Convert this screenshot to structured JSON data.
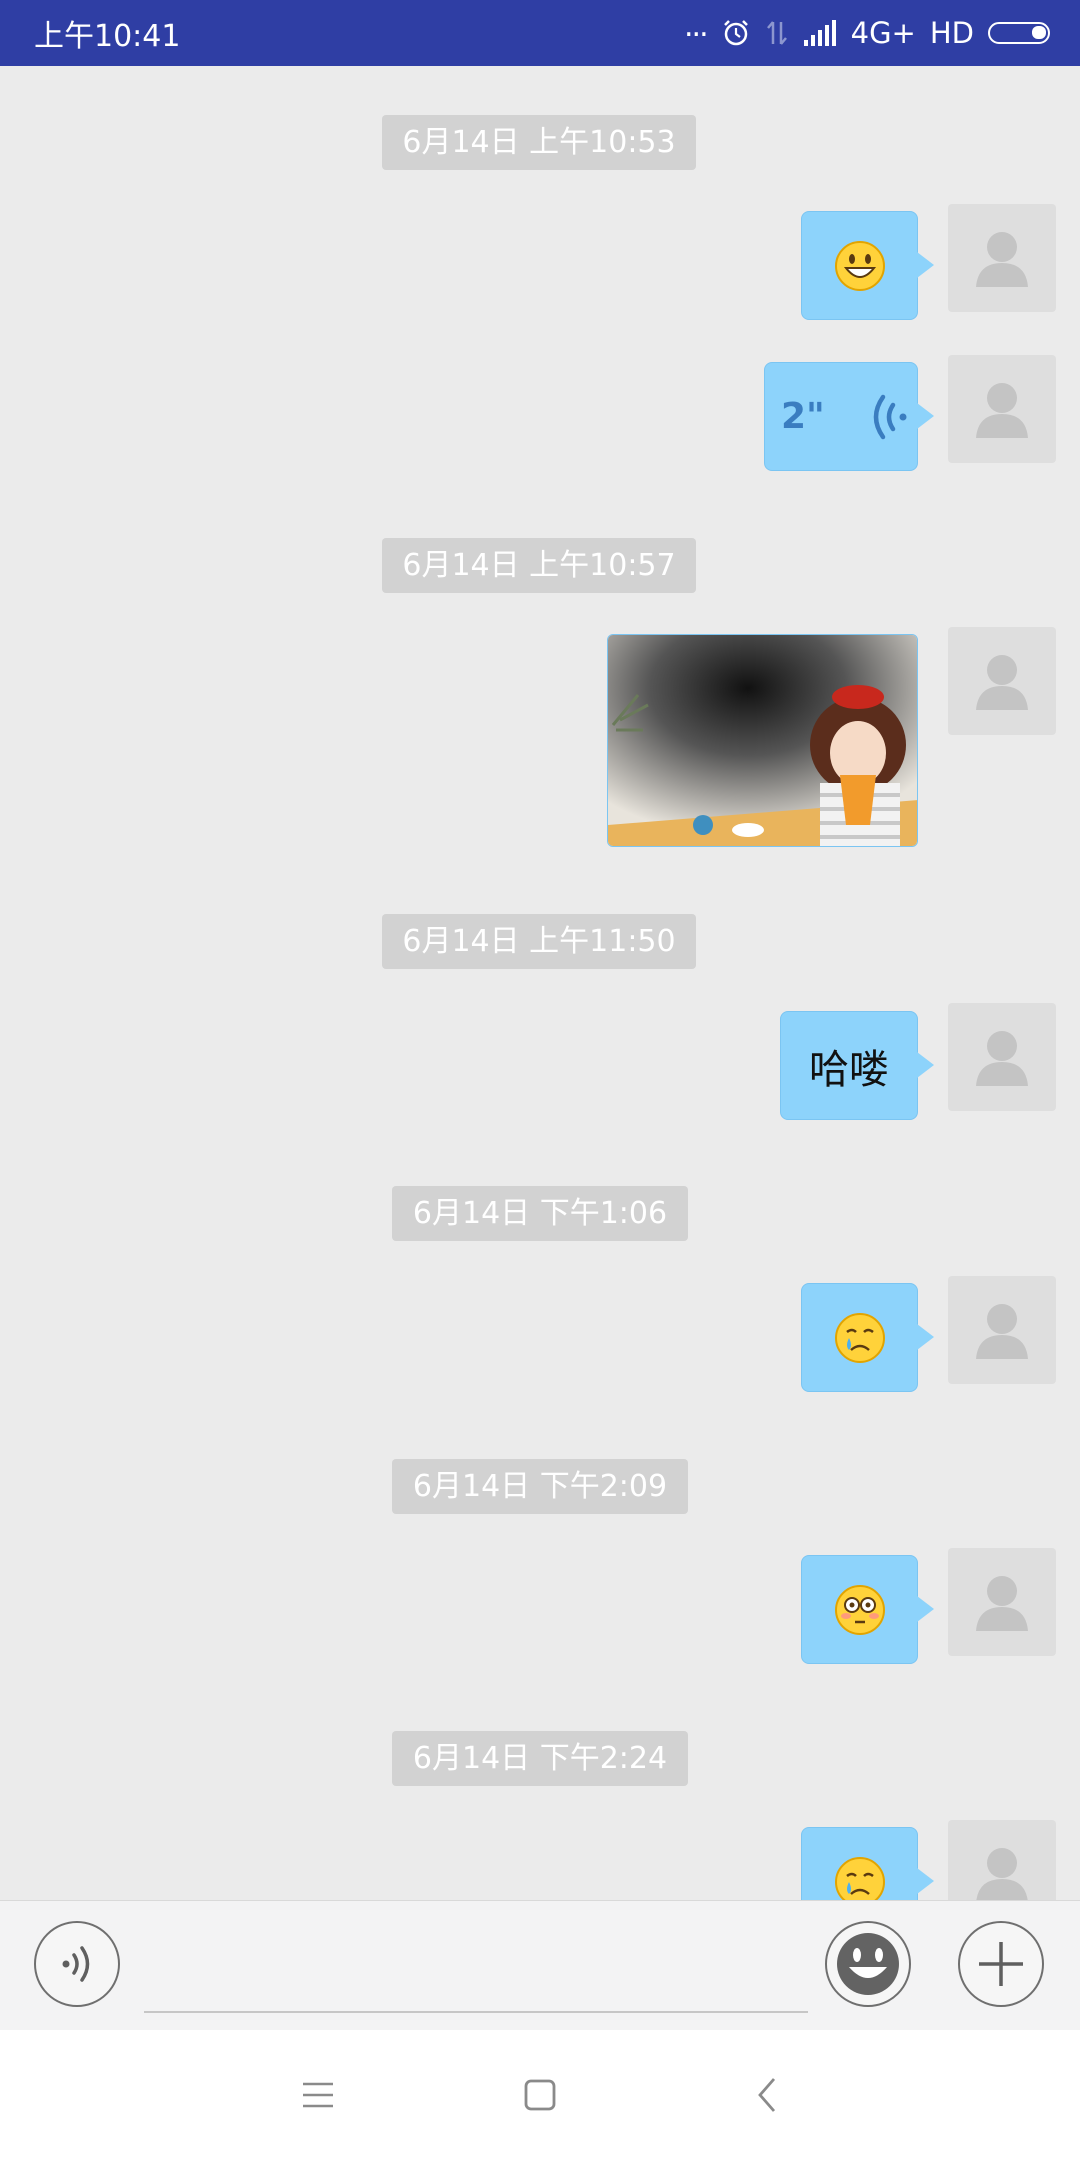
{
  "status_bar": {
    "time": "上午10:41",
    "dots": "...",
    "network": "4G+",
    "hd": "HD"
  },
  "messages": [
    {
      "type": "time",
      "text": "6月14日 上午10:53"
    },
    {
      "type": "emoji",
      "icon": "grinning-face-icon"
    },
    {
      "type": "voice",
      "duration": "2\""
    },
    {
      "type": "time",
      "text": "6月14日 上午10:57"
    },
    {
      "type": "image",
      "description_icon": "photo-thumbnail"
    },
    {
      "type": "time",
      "text": "6月14日 上午11:50"
    },
    {
      "type": "text",
      "text": "哈喽"
    },
    {
      "type": "time",
      "text": "6月14日 下午1:06"
    },
    {
      "type": "emoji",
      "icon": "crying-face-icon"
    },
    {
      "type": "time",
      "text": "6月14日 下午2:09"
    },
    {
      "type": "emoji",
      "icon": "flushed-face-icon"
    },
    {
      "type": "time",
      "text": "6月14日 下午2:24"
    },
    {
      "type": "emoji",
      "icon": "crying-face-icon"
    }
  ],
  "input_bar": {
    "input_value": "",
    "voice_icon": "voice-input-icon",
    "emoji_icon": "emoji-smile-icon",
    "add_icon": "plus-icon"
  },
  "nav_bar": {
    "menu_icon": "menu-icon",
    "home_icon": "home-square-icon",
    "back_icon": "back-chevron-icon"
  },
  "colors": {
    "status_bar": "#2f3ea4",
    "bubble": "#8dd3fb",
    "chat_bg": "#ebebeb",
    "time_pill": "#d2d2d2"
  }
}
